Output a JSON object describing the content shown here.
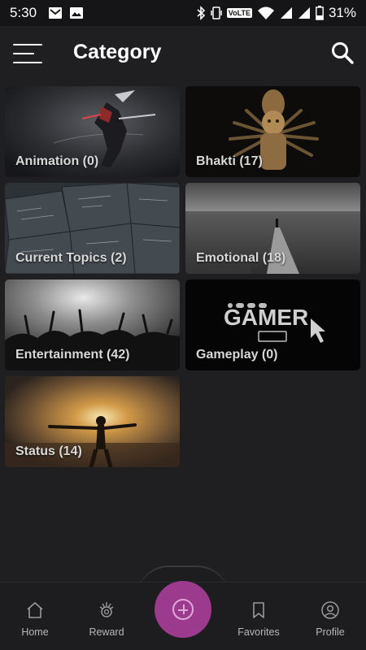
{
  "status_bar": {
    "time": "5:30",
    "network_badge": "VoLTE",
    "battery": "31%"
  },
  "header": {
    "title": "Category"
  },
  "categories": [
    {
      "label": "Animation (0)",
      "image": "animation-warrior"
    },
    {
      "label": "Bhakti  (17)",
      "image": "deity-statue"
    },
    {
      "label": "Current Topics (2)",
      "image": "chalkboard"
    },
    {
      "label": "Emotional  (18)",
      "image": "pier-sea"
    },
    {
      "label": "Entertainment  (42)",
      "image": "concert-crowd"
    },
    {
      "label": "Gameplay  (0)",
      "image": "gamer-logo"
    },
    {
      "label": "Status (14)",
      "image": "sunset-silhouette"
    }
  ],
  "gamer_logo_text": "GAMER",
  "bottom_nav": {
    "home": "Home",
    "reward": "Reward",
    "favorites": "Favorites",
    "profile": "Profile"
  },
  "colors": {
    "background": "#1f1e20",
    "fab": "#9c3a8e",
    "nav_background": "#1d1c1e"
  }
}
